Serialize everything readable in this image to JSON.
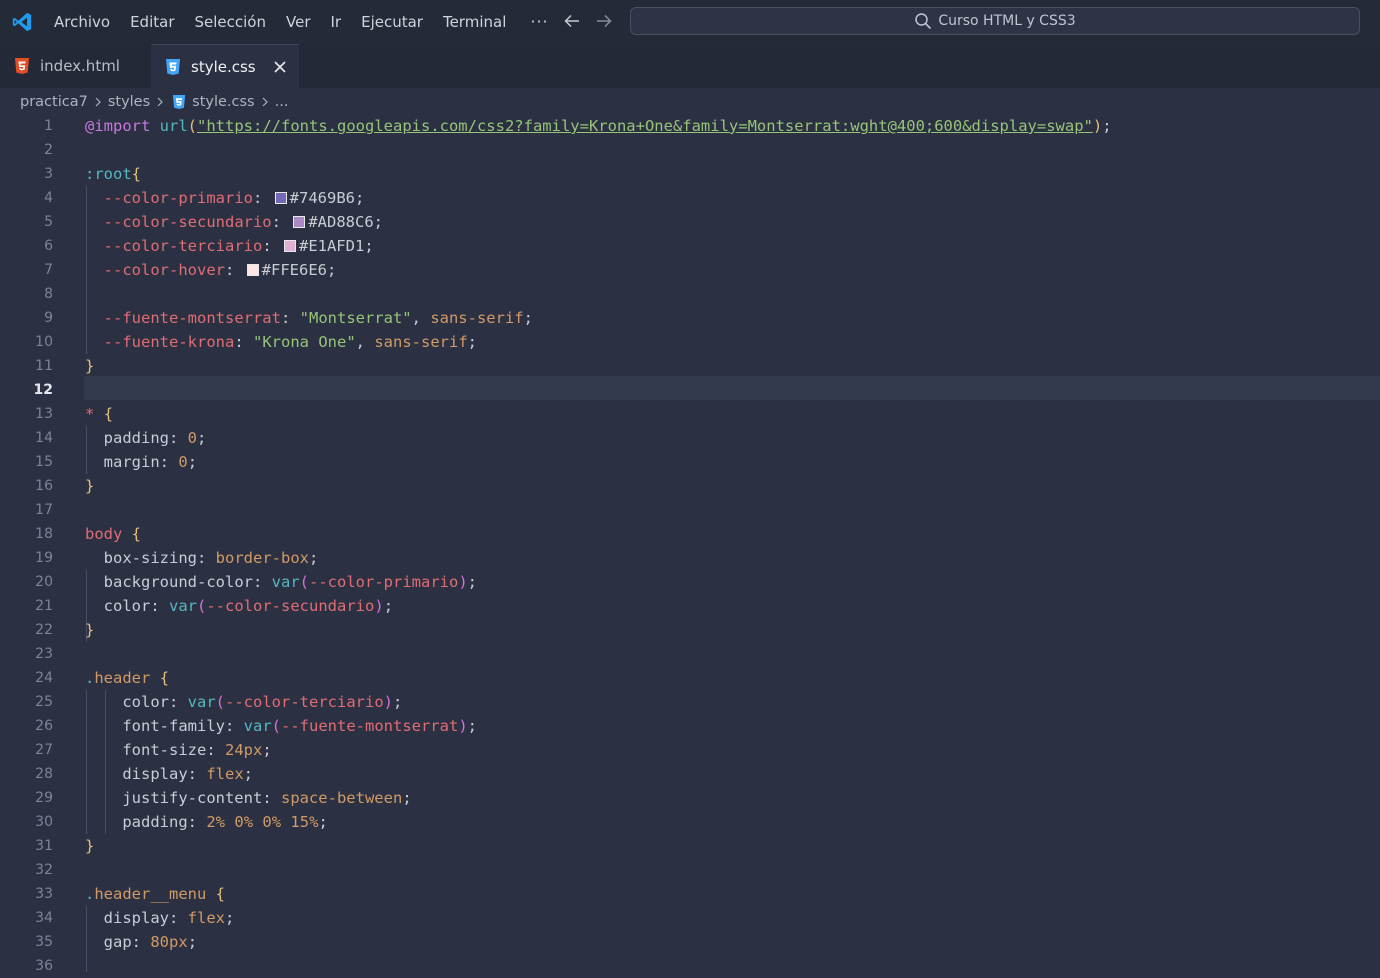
{
  "menu": [
    "Archivo",
    "Editar",
    "Selección",
    "Ver",
    "Ir",
    "Ejecutar",
    "Terminal"
  ],
  "menu_more": "···",
  "command_center": "Curso HTML y CSS3",
  "tabs": [
    {
      "label": "index.html",
      "icon": "html5-icon",
      "active": false
    },
    {
      "label": "style.css",
      "icon": "css3-icon",
      "active": true
    }
  ],
  "breadcrumb": {
    "folder": "practica7",
    "subfolder": "styles",
    "file": "style.css",
    "more": "..."
  },
  "editor": {
    "active_line": 12,
    "swatch_colors": {
      "primario": "#7469B6",
      "secundario": "#AD88C6",
      "terciario": "#E1AFD1",
      "hover": "#FFE6E6"
    },
    "lines": [
      "@import url(\"https://fonts.googleapis.com/css2?family=Krona+One&family=Montserrat:wght@400;600&display=swap\");",
      "",
      ":root{",
      "  --color-primario: #7469B6;",
      "  --color-secundario: #AD88C6;",
      "  --color-terciario: #E1AFD1;",
      "  --color-hover: #FFE6E6;",
      "",
      "  --fuente-montserrat: \"Montserrat\", sans-serif;",
      "  --fuente-krona: \"Krona One\", sans-serif;",
      "}",
      "",
      "* {",
      "  padding: 0;",
      "  margin: 0;",
      "}",
      "",
      "body {",
      "  box-sizing: border-box;",
      "  background-color: var(--color-primario);",
      "  color: var(--color-secundario);",
      "}",
      "",
      ".header {",
      "    color: var(--color-terciario);",
      "    font-family: var(--fuente-montserrat);",
      "    font-size: 24px;",
      "    display: flex;",
      "    justify-content: space-between;",
      "    padding: 2% 0% 0% 15%;",
      "}",
      "",
      ".header__menu {",
      "  display: flex;",
      "  gap: 80px;",
      ""
    ]
  },
  "colors": {
    "accent": "#0098ff",
    "html_icon": "#e44d26",
    "css_icon": "#42a5f5"
  }
}
